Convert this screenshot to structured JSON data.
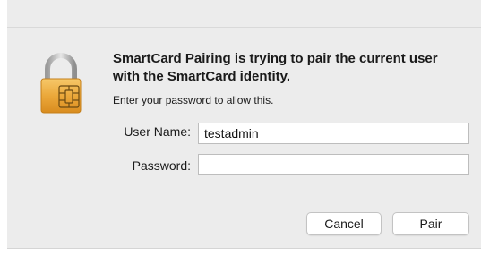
{
  "dialog": {
    "heading": "SmartCard Pairing is trying to pair the current user with the SmartCard identity.",
    "instruction": "Enter your password to allow this.",
    "icon": "padlock-smartcard-icon",
    "fields": {
      "username_label": "User Name:",
      "username_value": "testadmin",
      "password_label": "Password:",
      "password_value": ""
    },
    "buttons": {
      "cancel": "Cancel",
      "pair": "Pair"
    }
  },
  "colors": {
    "background": "#ececec",
    "lock_gold": "#e9a93a",
    "shackle_gray": "#b7b7b7"
  }
}
